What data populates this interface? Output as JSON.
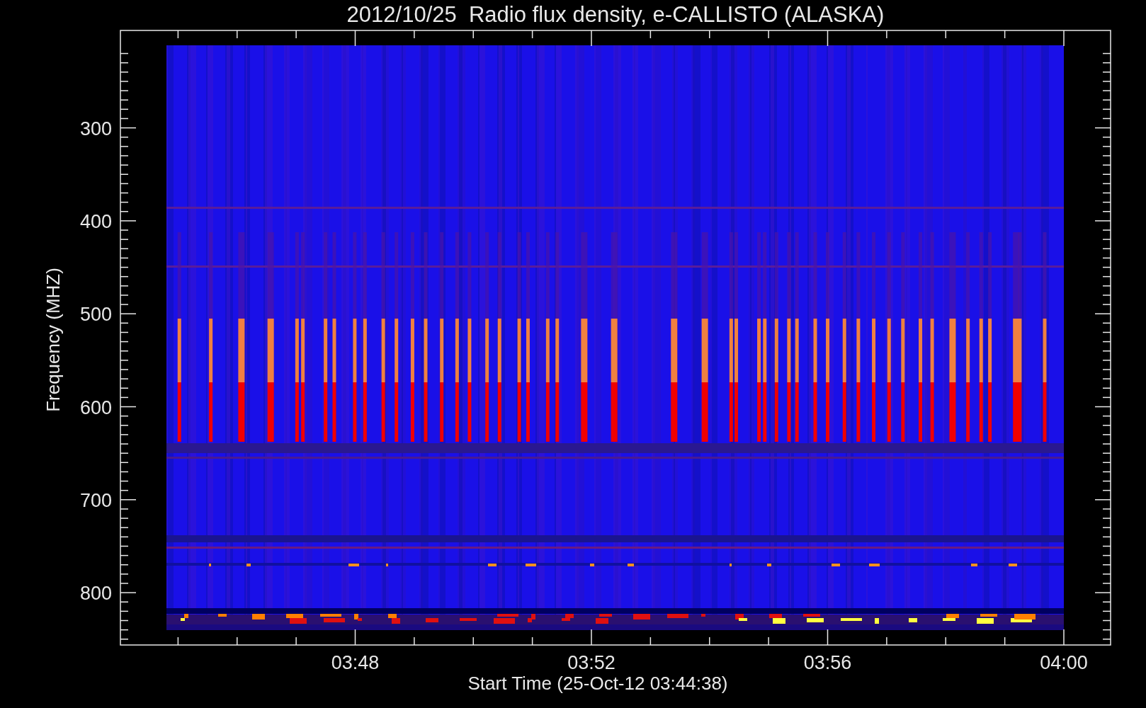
{
  "title": "2012/10/25  Radio flux density, e-CALLISTO (ALASKA)",
  "y_axis": {
    "label": "Frequency (MHZ)",
    "ticks": [
      "300",
      "400",
      "500",
      "600",
      "700",
      "800"
    ]
  },
  "x_axis": {
    "label": "Start Time (25-Oct-12 03:44:38)",
    "ticks": [
      "03:48",
      "03:52",
      "03:56",
      "04:00"
    ]
  }
}
